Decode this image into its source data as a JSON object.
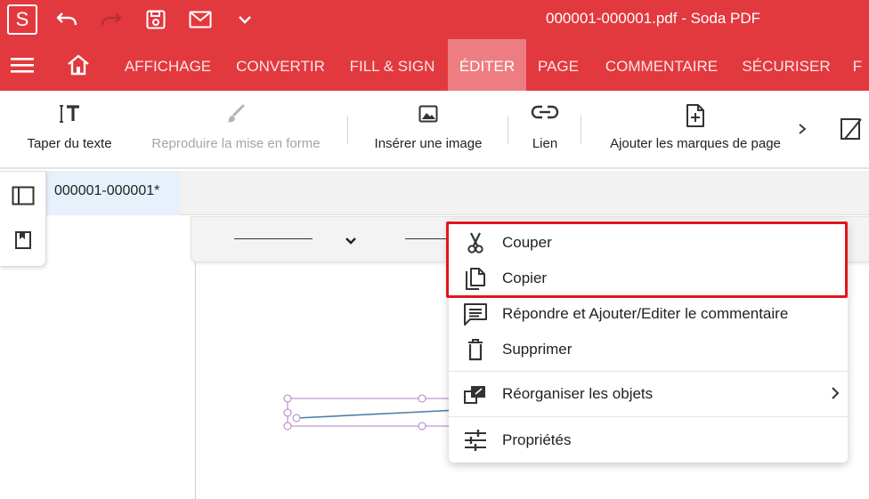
{
  "app": {
    "logo_letter": "S",
    "window_title": "000001-000001.pdf  -  Soda PDF",
    "brand_color": "#e2393f"
  },
  "quick_access": {
    "icons": [
      "undo-icon",
      "redo-icon",
      "save-icon",
      "mail-icon",
      "chevron-down-icon"
    ]
  },
  "menubar": {
    "items": [
      {
        "label": "AFFICHAGE"
      },
      {
        "label": "CONVERTIR"
      },
      {
        "label": "FILL & SIGN"
      },
      {
        "label": "ÉDITER",
        "active": true
      },
      {
        "label": "PAGE"
      },
      {
        "label": "COMMENTAIRE"
      },
      {
        "label": "SÉCURISER"
      },
      {
        "label": "F"
      }
    ]
  },
  "ribbon": {
    "buttons": [
      {
        "label": "Taper du texte",
        "icon": "text-cursor-icon",
        "enabled": true
      },
      {
        "label": "Reproduire la mise en forme",
        "icon": "brush-icon",
        "enabled": false
      },
      {
        "label": "Insérer une image",
        "icon": "image-icon",
        "enabled": true
      },
      {
        "label": "Lien",
        "icon": "link-icon",
        "enabled": true
      },
      {
        "label": "Ajouter les marques de page",
        "icon": "add-page-icon",
        "enabled": true
      }
    ]
  },
  "document_tab": {
    "label": "000001-000001*"
  },
  "context_menu": {
    "items": [
      {
        "label": "Couper",
        "icon": "scissors-icon"
      },
      {
        "label": "Copier",
        "icon": "copy-icon"
      },
      {
        "label": "Répondre et Ajouter/Editer le commentaire",
        "icon": "comment-icon"
      },
      {
        "label": "Supprimer",
        "icon": "trash-icon"
      },
      {
        "label": "Réorganiser les objets",
        "icon": "arrange-icon",
        "has_submenu": true
      },
      {
        "label": "Propriétés",
        "icon": "sliders-icon"
      }
    ],
    "highlight_color": "#e0161c"
  }
}
